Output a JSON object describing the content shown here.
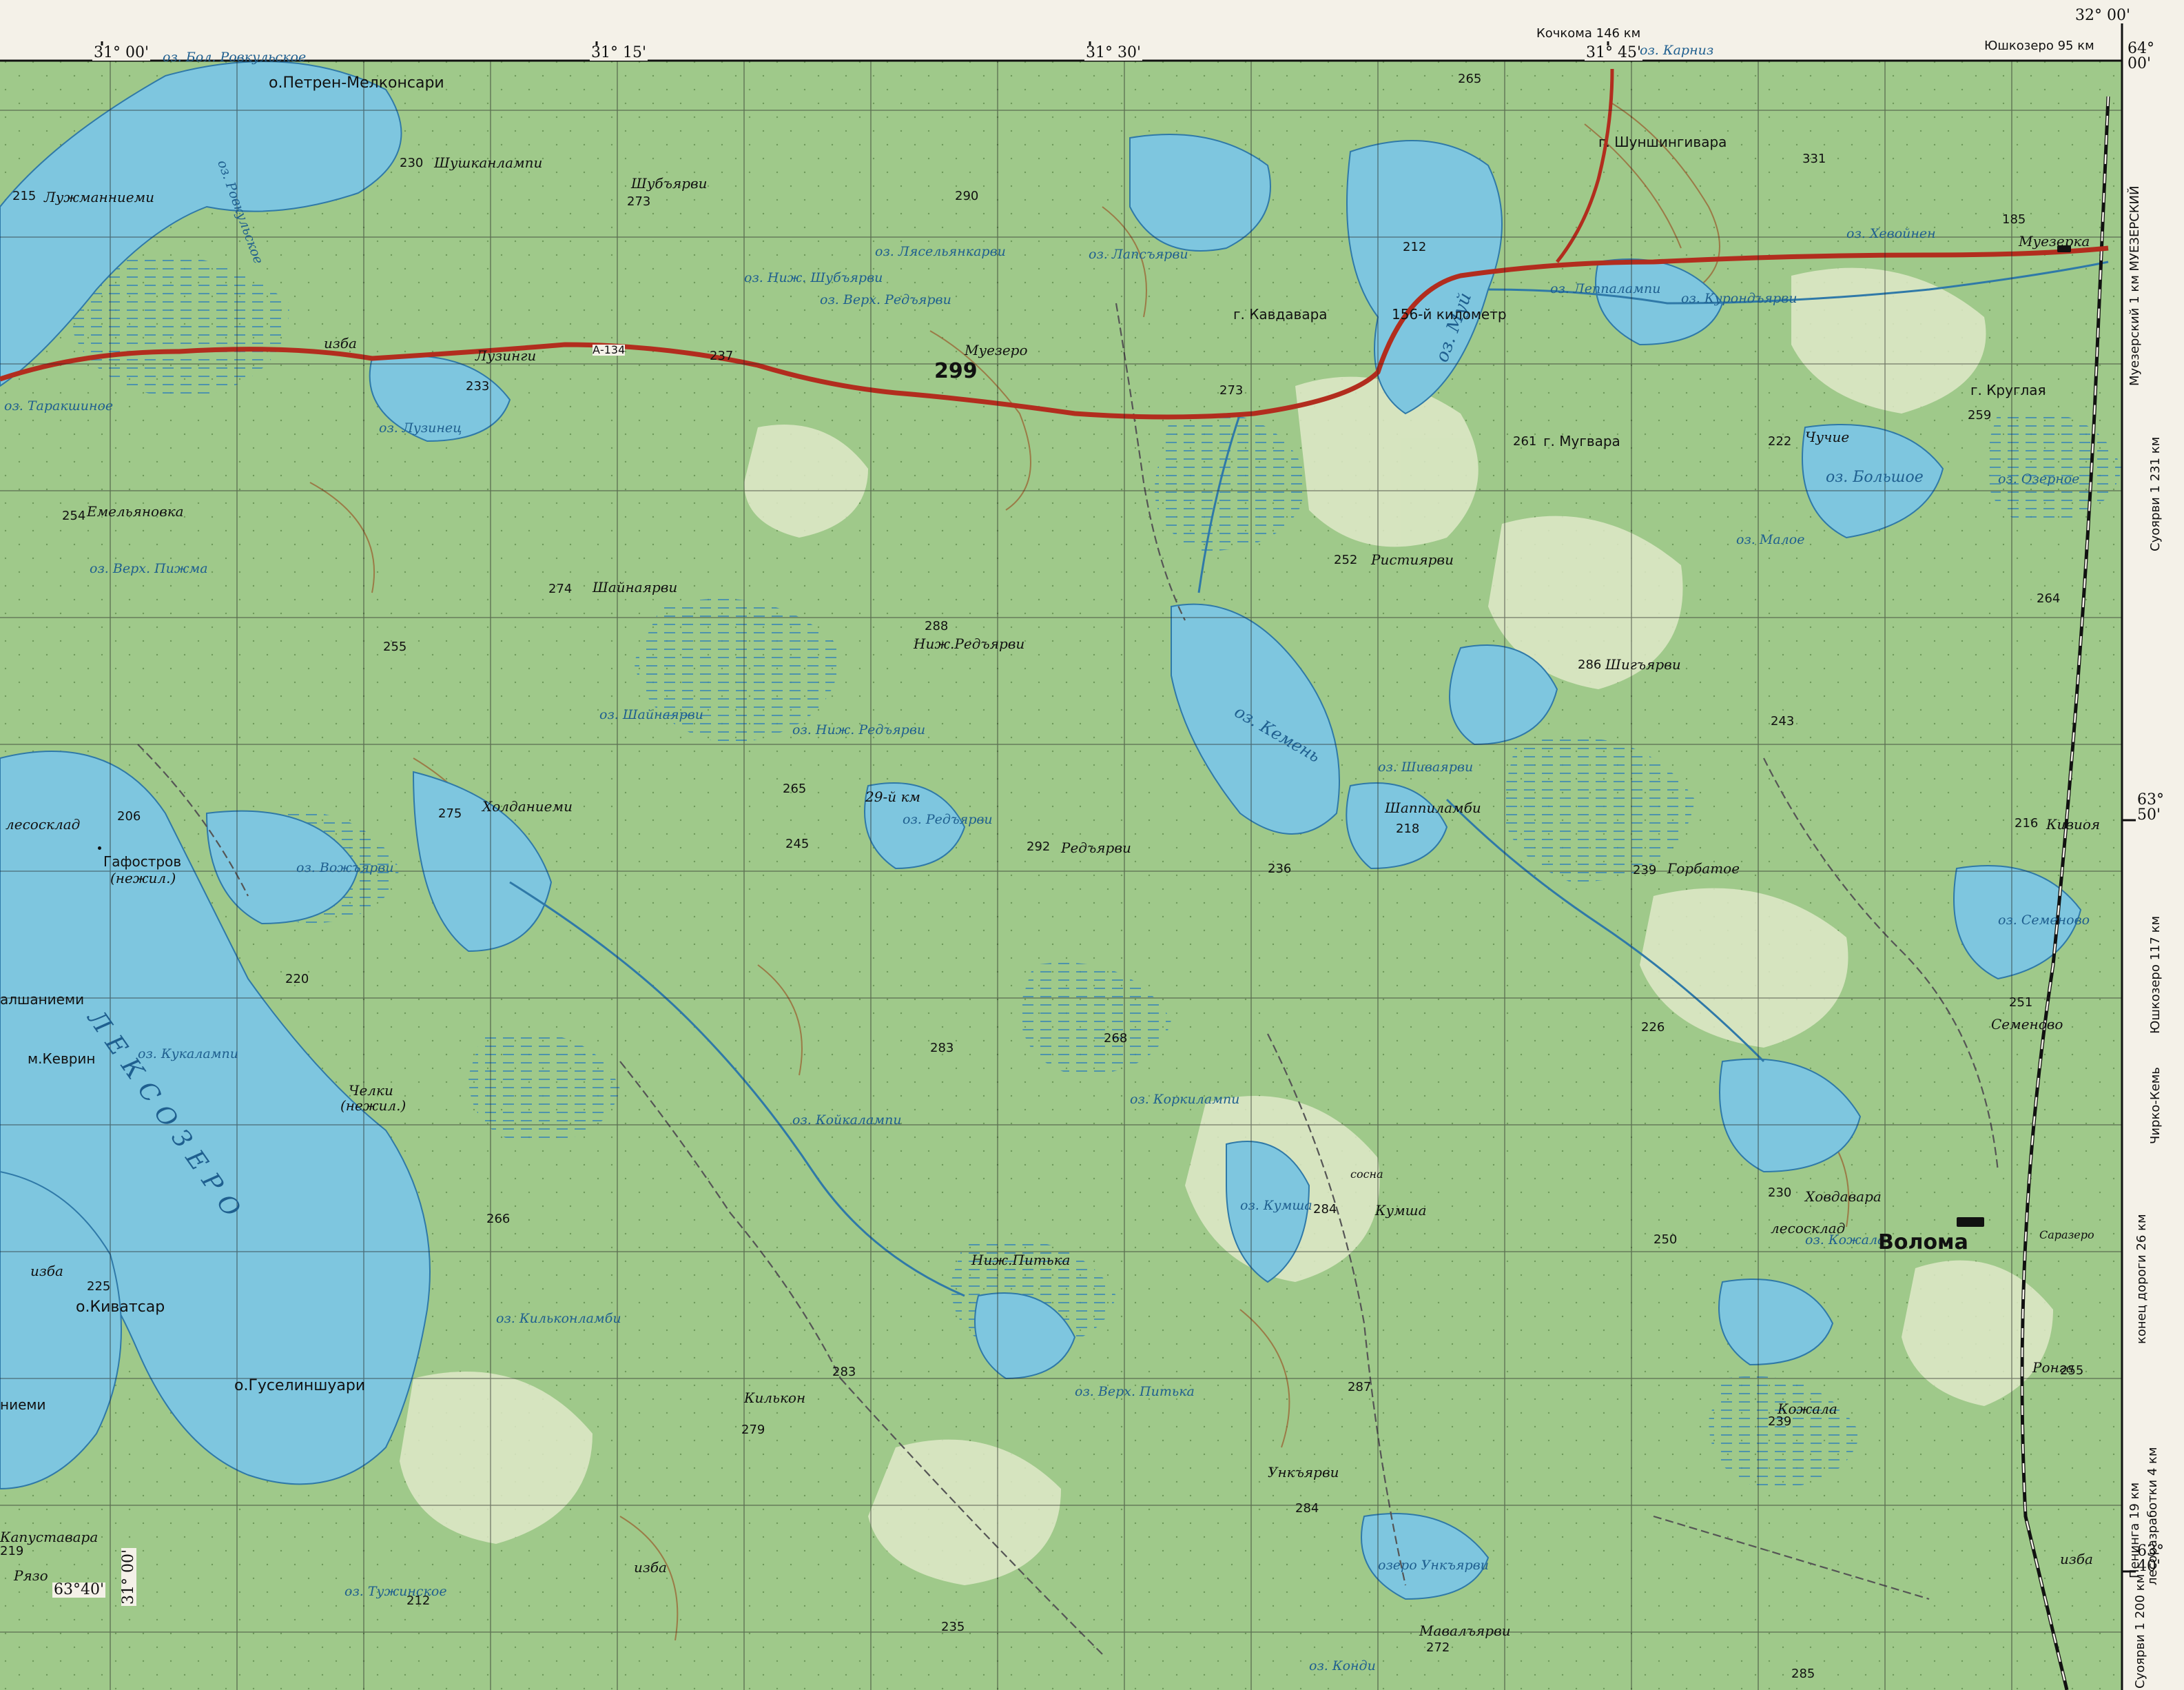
{
  "colors": {
    "forest": "#9fc98a",
    "open": "#dfe9c8",
    "water": "#7ec6df",
    "road": "#b22d1e",
    "contour": "#9a5a2b",
    "grid": "#222222",
    "frame": "#f4f1e8"
  },
  "coords": {
    "lon": [
      "31° 00'",
      "31° 15'",
      "31° 30'",
      "31° 45'",
      "32° 00'"
    ],
    "lat_top": "64° 00'",
    "lat_mid": "63° 50'",
    "lat_bottom": "63° 40'",
    "corner_bl_lat": "63°40'",
    "corner_bl_lon": "31° 00'"
  },
  "edge_notes": {
    "kochkoma": "Кочкома 146 км",
    "yushkozero_top": "Юшкозеро 95 км",
    "muezersky": "Муезерский 1 км МУЕЗЕРСКИЙ",
    "suoyarvi_231": "Суоярви 1 231 км",
    "yushkozero_117": "Юшкозеро 117 км",
    "chirko": "Чирко-Кемь",
    "end_road": "конец дороги 26 км",
    "penninga": "Пенинга 19 км",
    "lesorazrabotki": "лесоразработки 4 км",
    "suoyarvi_200": "Суоярви 1 200 км"
  },
  "places": {
    "petren": "о.Петрен-Мелконсари",
    "luzhmanniemi": "Лужманниеми",
    "shushkanlampi": "Шушканлампи",
    "shubyarvi": "Шубъярви",
    "luzinga": "Лузинги",
    "izba1": "изба",
    "muezero": "Муезеро",
    "kavdavara": "г. Кавдавара",
    "km156": "156-й километр",
    "shunshingivara": "г. Шуншингивара",
    "muezerka": "Муезерка",
    "krugla": "г. Круглая",
    "mugvara": "г. Мугвара",
    "chuchie": "Чучие",
    "emelyanovka": "Емельяновка",
    "ristiyarvi": "Ристиярви",
    "shainyarvi": "Шайнаярви",
    "nizh_redyarvi": "Ниж.Редъярви",
    "shigyarvi": "Шигъярви",
    "lesosklad": "лесосклад",
    "gafostrov": "Гафостров",
    "nezhil": "(нежил.)",
    "holdaniemi": "Холданиеми",
    "km29": "29-й км",
    "redyarvi": "Редъярви",
    "shoppilamba": "Шаппиламби",
    "gorbatoe": "Горбатое",
    "kivioya": "Кивиоя",
    "alshaniemi": "алшаниеми",
    "m_kevrin": "м.Кеврин",
    "chelki": "Челки",
    "chelki_nezhil": "(нежил.)",
    "semenovo": "Семеново",
    "kumsha": "Кумша",
    "sosna": "сосна",
    "hovdavara": "Ховдавара",
    "lesosklad2": "лесосклад",
    "voloma": "Волома",
    "nizh_pitka": "Ниж.Питька",
    "izba_kivatsar": "изба",
    "kivatsar": "о.Киватсар",
    "guselinshuari": "о.Гуселиншуари",
    "kilkon": "Килькон",
    "kozhala": "Кожала",
    "ronga": "Ронга",
    "unkyarvi": "Ункъярви",
    "kapustavara": "Капуставара",
    "ryzo": "Рязо",
    "mavalyarvi": "Мавалъярви",
    "niemi": "ниеми",
    "izba_s": "изба",
    "izba_se": "изба",
    "saravozero": "Саразеро"
  },
  "water": {
    "bol_rovkulskoe": "оз. Бол. Ровкульское",
    "rovkulskoe": "оз. Ровкульское",
    "tarakshinoe": "оз. Таракшиное",
    "luzinets": "оз. Лузинец",
    "lyaselyankarvi": "оз. Лясельянкарви",
    "nizh_shubyarvi": "оз. Ниж. Шубъярви",
    "verh_redyarvi": "оз. Верх. Редъярви",
    "lapsyarvi": "оз. Лапсъярви",
    "myui": "оз. Муй",
    "karniz": "оз. Карниз",
    "hevoinen": "оз. Хевойнен",
    "leppalampi": "оз. Леппалампи",
    "kurondyarvi": "оз. Курондъярви",
    "bolshoe": "оз. Большое",
    "maloe": "оз. Малое",
    "vertpizhma": "оз. Верх. Пижма",
    "shainyarvi": "оз. Шайнаярви",
    "kemen": "оз. Кемень",
    "shivayarvi": "оз. Шиваярви",
    "nizh_redyarvi": "оз. Ниж. Редъярви",
    "redyarvi": "оз. Редъярви",
    "vozhyarvi": "оз. Вожъярви",
    "lezhuzero": "ЛЕКСОЗЕРО",
    "kukalampi": "оз. Кукалампи",
    "koikalampi": "оз. Койкалампи",
    "korkilampi": "оз. Коркилампи",
    "kumsha": "оз. Кумша",
    "unkyarvi": "озеро Ункъярви",
    "kozhala": "оз. Кожала",
    "vert_pitka": "оз. Верх. Питька",
    "kilkon": "оз. Кильконламби",
    "semenovo": "оз. Семеново",
    "ozernoe": "оз. Озерное",
    "kondi": "оз. Конди",
    "tuzhinskoe": "оз. Тужинское"
  },
  "elevations": [
    "215",
    "230",
    "273",
    "290",
    "233",
    "237",
    "299",
    "273",
    "265",
    "331",
    "185",
    "212",
    "259",
    "222",
    "261",
    "254",
    "274",
    "255",
    "252",
    "288",
    "286",
    "243",
    "264",
    "206",
    "275",
    "265",
    "245",
    "292",
    "236",
    "239",
    "218",
    "216",
    "220",
    "283",
    "268",
    "226",
    "251",
    "266",
    "284",
    "230",
    "250",
    "225",
    "283",
    "279",
    "287",
    "239",
    "255",
    "284",
    "219",
    "212",
    "235",
    "272",
    "285"
  ],
  "roads": {
    "a134": "А-134"
  }
}
